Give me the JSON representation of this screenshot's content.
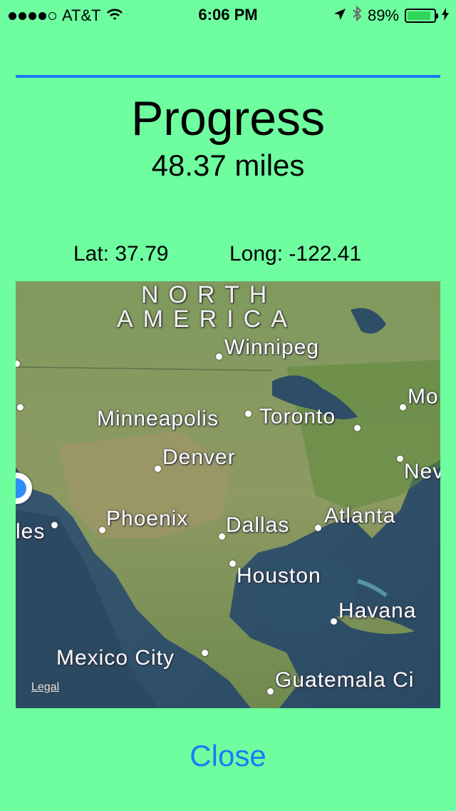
{
  "status_bar": {
    "carrier": "AT&T",
    "time": "6:06 PM",
    "battery_percent": "89%",
    "battery_level": 0.89,
    "signal_bars": 4,
    "signal_max": 5,
    "icons": [
      "wifi-icon",
      "location-arrow-icon",
      "bluetooth-icon",
      "battery-icon",
      "charging-bolt-icon"
    ]
  },
  "header": {
    "title": "Progress",
    "distance": "48.37 miles"
  },
  "coordinates": {
    "lat_text": "Lat: 37.79",
    "long_text": "Long: -122.41"
  },
  "map": {
    "region_labels": [
      "NORTH",
      "AMERICA"
    ],
    "cities": [
      "Winnipeg",
      "Mo",
      "Minneapolis",
      "Toronto",
      "Denver",
      "Nev",
      "les",
      "Phoenix",
      "Dallas",
      "Atlanta",
      "Houston",
      "Havana",
      "Mexico City",
      "Guatemala Ci"
    ],
    "legal": "Legal"
  },
  "close_label": "Close",
  "colors": {
    "background": "#6efea0",
    "accent": "#1a7cf5",
    "user_location": "#2f8ef5"
  }
}
